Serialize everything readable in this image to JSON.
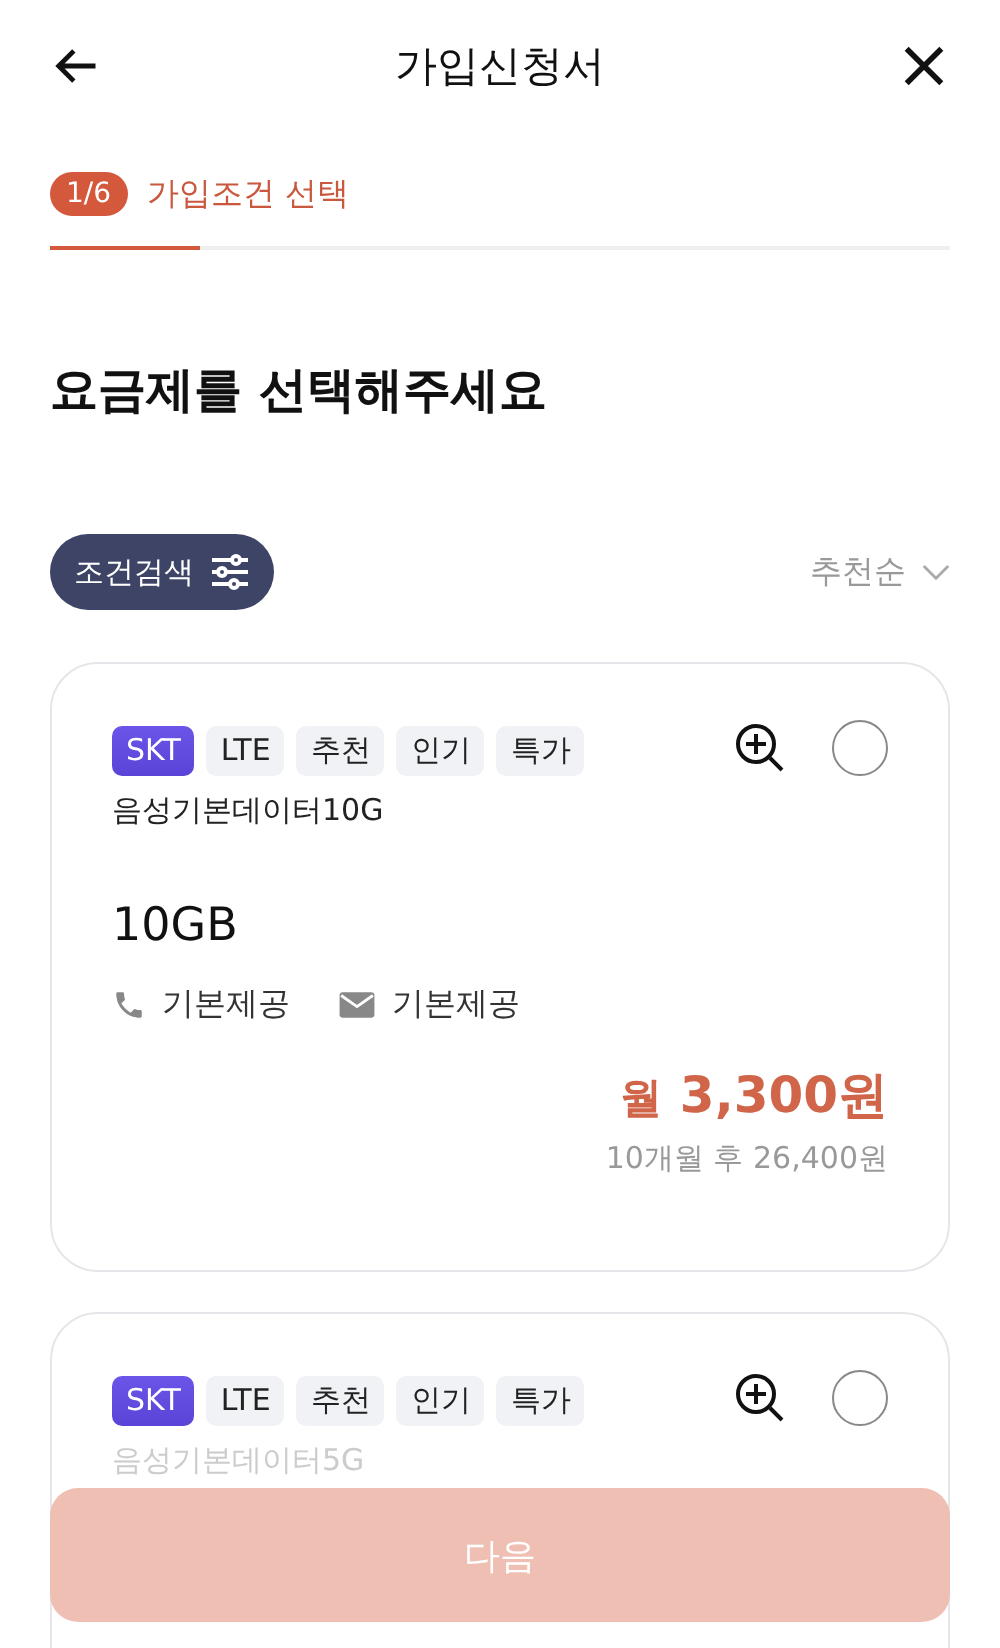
{
  "header": {
    "title": "가입신청서"
  },
  "step": {
    "badge": "1/6",
    "label": "가입조건 선택",
    "level": 0.167
  },
  "heading": "요금제를 선택해주세요",
  "filter": {
    "button": "조건검색",
    "sort": "추천순"
  },
  "plans": [
    {
      "selected": false,
      "tags": [
        {
          "label": "SKT",
          "kind": "carrier"
        },
        {
          "label": "LTE",
          "kind": "plain"
        },
        {
          "label": "추천",
          "kind": "plain"
        },
        {
          "label": "인기",
          "kind": "plain"
        },
        {
          "label": "특가",
          "kind": "plain"
        }
      ],
      "name": "음성기본데이터10G",
      "data": "10GB",
      "voice": "기본제공",
      "sms": "기본제공",
      "price_prefix": "월",
      "price": "3,300원",
      "price_note": "10개월 후 26,400원"
    },
    {
      "selected": false,
      "tags": [
        {
          "label": "SKT",
          "kind": "carrier"
        },
        {
          "label": "LTE",
          "kind": "plain"
        },
        {
          "label": "추천",
          "kind": "plain"
        },
        {
          "label": "인기",
          "kind": "plain"
        },
        {
          "label": "특가",
          "kind": "plain"
        }
      ],
      "name": "음성기본데이터5G"
    }
  ],
  "next_button": {
    "label": "다음",
    "disabled": true
  }
}
